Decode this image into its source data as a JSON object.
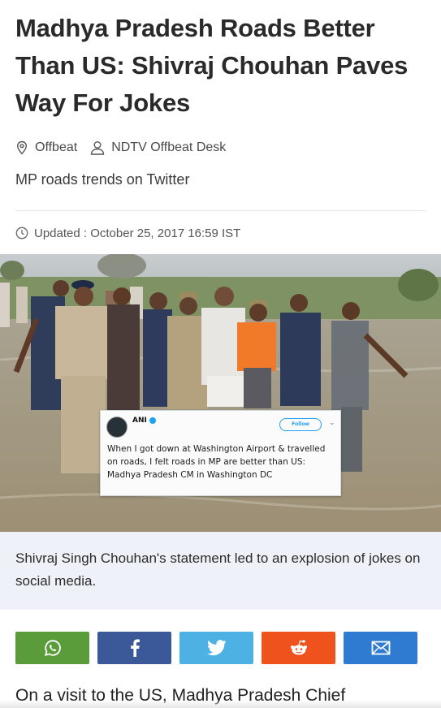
{
  "article": {
    "headline": "Madhya Pradesh Roads Better Than US: Shivraj Chouhan Paves Way For Jokes",
    "category": "Offbeat",
    "author": "NDTV Offbeat Desk",
    "subhead": "MP roads trends on Twitter",
    "updated": "Updated : October 25, 2017 16:59 IST",
    "image_caption": "Shivraj Singh Chouhan's statement led to an explosion of jokes on social media.",
    "body_first_line": "On a visit to the US, Madhya Pradesh Chief"
  },
  "tweet": {
    "handle": "ANI",
    "follow_label": "Follow",
    "text": "When I got down at Washington Airport & travelled on roads, I felt roads in MP are better than US: Madhya Pradesh CM in Washington DC"
  },
  "share": {
    "buttons": [
      {
        "name": "whatsapp",
        "icon": "whatsapp-icon",
        "color": "#5a9c3a"
      },
      {
        "name": "facebook",
        "icon": "facebook-icon",
        "color": "#3b5998"
      },
      {
        "name": "twitter",
        "icon": "twitter-icon",
        "color": "#4db2e3"
      },
      {
        "name": "reddit",
        "icon": "reddit-icon",
        "color": "#f0521e"
      },
      {
        "name": "email",
        "icon": "email-icon",
        "color": "#2f7bd1"
      }
    ]
  },
  "icons": {
    "category": "location-pin-icon",
    "author": "person-icon",
    "updated": "clock-icon"
  }
}
